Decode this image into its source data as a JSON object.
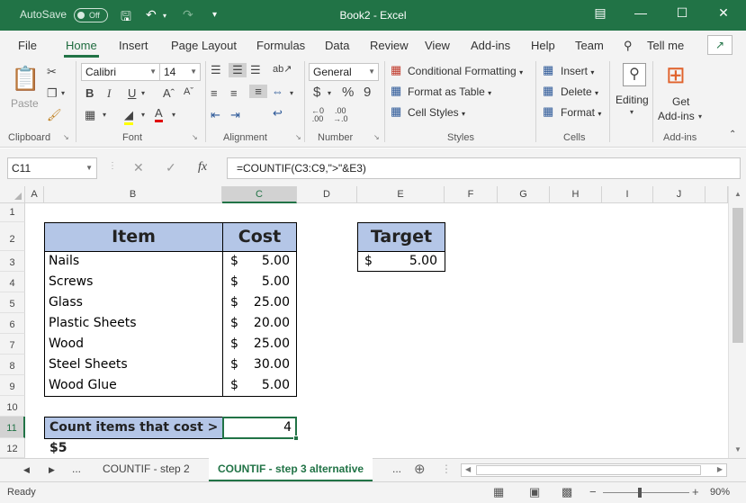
{
  "titlebar": {
    "autosave_label": "AutoSave",
    "autosave_state": "Off",
    "title": "Book2  -  Excel"
  },
  "tabs": [
    "File",
    "Home",
    "Insert",
    "Page Layout",
    "Formulas",
    "Data",
    "Review",
    "View",
    "Add-ins",
    "Help",
    "Team"
  ],
  "active_tab": "Home",
  "tell_me": "Tell me",
  "ribbon": {
    "clipboard": {
      "paste": "Paste",
      "label": "Clipboard"
    },
    "font": {
      "name": "Calibri",
      "size": "14",
      "bold": "B",
      "italic": "I",
      "underline": "U",
      "label": "Font"
    },
    "alignment": {
      "label": "Alignment"
    },
    "number": {
      "format": "General",
      "currency": "$",
      "percent": "%",
      "comma": "9",
      "label": "Number"
    },
    "styles": {
      "conditional": "Conditional Formatting",
      "format_table": "Format as Table",
      "cell_styles": "Cell Styles",
      "label": "Styles"
    },
    "cells": {
      "insert": "Insert",
      "delete": "Delete",
      "format": "Format",
      "label": "Cells"
    },
    "editing": {
      "label": "Editing"
    },
    "addins": {
      "get": "Get",
      "addins": "Add-ins",
      "label": "Add-ins"
    }
  },
  "formula_bar": {
    "name_box": "C11",
    "fx": "fx",
    "formula": "=COUNTIF(C3:C9,\">\"&E3)"
  },
  "columns": [
    "A",
    "B",
    "C",
    "D",
    "E",
    "F",
    "G",
    "H",
    "I",
    "J"
  ],
  "rows": [
    "1",
    "2",
    "3",
    "4",
    "5",
    "6",
    "7",
    "8",
    "9",
    "10",
    "11",
    "12"
  ],
  "table": {
    "header_item": "Item",
    "header_cost": "Cost",
    "items": [
      {
        "name": "Nails",
        "currency": "$",
        "cost": "5.00"
      },
      {
        "name": "Screws",
        "currency": "$",
        "cost": "5.00"
      },
      {
        "name": "Glass",
        "currency": "$",
        "cost": "25.00"
      },
      {
        "name": "Plastic Sheets",
        "currency": "$",
        "cost": "20.00"
      },
      {
        "name": "Wood",
        "currency": "$",
        "cost": "25.00"
      },
      {
        "name": "Steel Sheets",
        "currency": "$",
        "cost": "30.00"
      },
      {
        "name": "Wood Glue",
        "currency": "$",
        "cost": "5.00"
      }
    ]
  },
  "target": {
    "header": "Target",
    "currency": "$",
    "value": "5.00"
  },
  "count": {
    "label": "Count items that cost > $5",
    "value": "4"
  },
  "sheet_tabs": {
    "ellipsis": "...",
    "tab1": "COUNTIF - step 2",
    "tab2": "COUNTIF - step 3 alternative",
    "ellipsis2": "..."
  },
  "status": {
    "ready": "Ready",
    "zoom": "90%"
  },
  "colors": {
    "excel_green": "#217346",
    "header_fill": "#b4c6e7"
  }
}
